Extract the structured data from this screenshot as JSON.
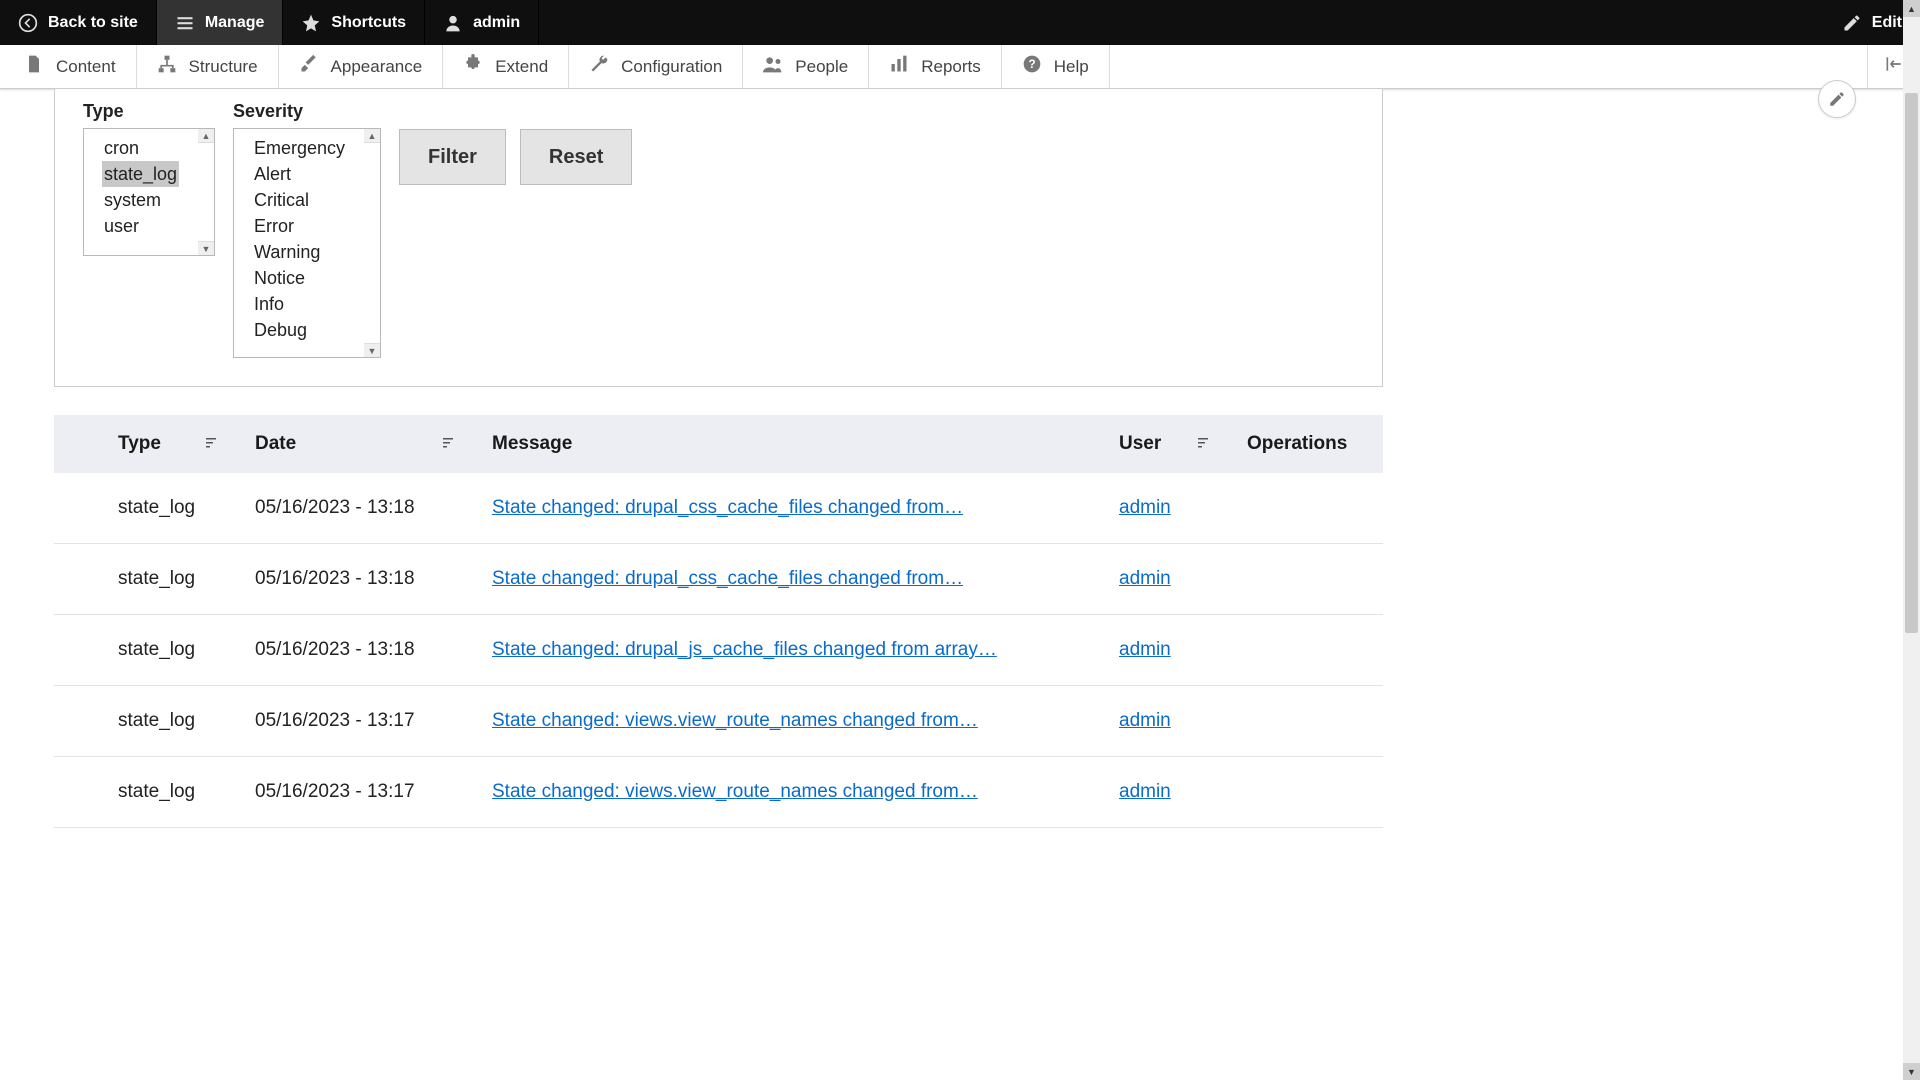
{
  "toolbar": {
    "back_label": "Back to site",
    "manage_label": "Manage",
    "shortcuts_label": "Shortcuts",
    "user_label": "admin",
    "edit_label": "Edit"
  },
  "admin_menu": {
    "content": "Content",
    "structure": "Structure",
    "appearance": "Appearance",
    "extend": "Extend",
    "configuration": "Configuration",
    "people": "People",
    "reports": "Reports",
    "help": "Help"
  },
  "filters": {
    "type_label": "Type",
    "severity_label": "Severity",
    "type_options": [
      "cron",
      "state_log",
      "system",
      "user"
    ],
    "type_selected": "state_log",
    "severity_options": [
      "Emergency",
      "Alert",
      "Critical",
      "Error",
      "Warning",
      "Notice",
      "Info",
      "Debug"
    ],
    "filter_btn": "Filter",
    "reset_btn": "Reset"
  },
  "table": {
    "headers": {
      "type": "Type",
      "date": "Date",
      "message": "Message",
      "user": "User",
      "operations": "Operations"
    },
    "rows": [
      {
        "type": "state_log",
        "date": "05/16/2023 - 13:18",
        "message": "State changed: drupal_css_cache_files changed from…",
        "user": "admin"
      },
      {
        "type": "state_log",
        "date": "05/16/2023 - 13:18",
        "message": "State changed: drupal_css_cache_files changed from…",
        "user": "admin"
      },
      {
        "type": "state_log",
        "date": "05/16/2023 - 13:18",
        "message": "State changed: drupal_js_cache_files changed from array…",
        "user": "admin"
      },
      {
        "type": "state_log",
        "date": "05/16/2023 - 13:17",
        "message": "State changed: views.view_route_names changed from…",
        "user": "admin"
      },
      {
        "type": "state_log",
        "date": "05/16/2023 - 13:17",
        "message": "State changed: views.view_route_names changed from…",
        "user": "admin"
      }
    ]
  }
}
